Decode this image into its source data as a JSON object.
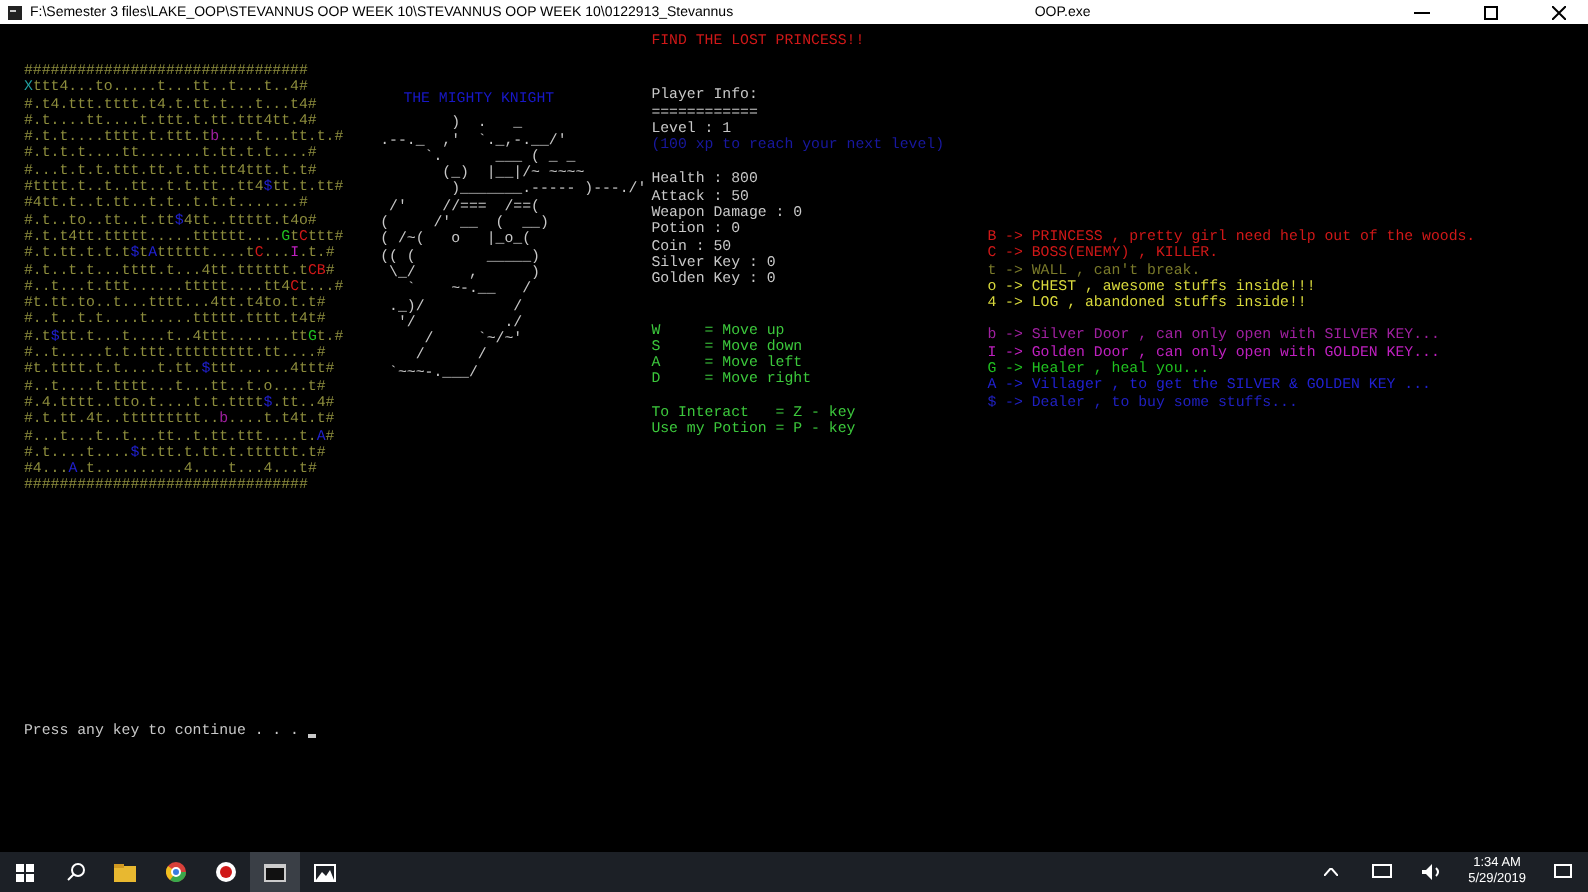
{
  "window": {
    "title": "F:\\Semester 3 files\\LAKE_OOP\\STEVANNUS OOP WEEK 10\\STEVANNUS OOP WEEK 10\\0122913_Stevannus",
    "title_end": "OOP.exe"
  },
  "map": {
    "rows": [
      {
        "segments": [
          {
            "text": "################################"
          }
        ]
      },
      {
        "segments": [
          {
            "text": "X",
            "color": "#20a0a0"
          },
          {
            "text": "ttt4...to.....t...tt..t...t..4#"
          }
        ]
      },
      {
        "segments": [
          {
            "text": "#.t4.ttt.tttt.t4.t.tt.t...t...t4#"
          }
        ]
      },
      {
        "segments": [
          {
            "text": "#.t....tt....t.ttt.t.tt.ttt4tt.4#"
          }
        ]
      },
      {
        "segments": [
          {
            "text": "#.t.t....tttt.t.ttt.t"
          },
          {
            "text": "b",
            "color": "#a020a0"
          },
          {
            "text": "....t...tt.t.#"
          }
        ]
      },
      {
        "segments": [
          {
            "text": "#.t.t.t....tt.......t.tt.t.t....#"
          }
        ]
      },
      {
        "segments": [
          {
            "text": "#...t.t.t.ttt.tt.t.tt.tt4ttt.t.t#"
          }
        ]
      },
      {
        "segments": [
          {
            "text": "#tttt.t..t..tt..t.t.tt..tt4"
          },
          {
            "text": "$",
            "color": "#2020d0"
          },
          {
            "text": "tt.t.tt#"
          }
        ]
      },
      {
        "segments": [
          {
            "text": "#4tt.t..t.tt..t.t..t.t.t.......#"
          }
        ]
      },
      {
        "segments": [
          {
            "text": "#.t..to..tt..t.tt"
          },
          {
            "text": "$",
            "color": "#2020d0"
          },
          {
            "text": "4tt..ttttt.t4o#"
          }
        ]
      },
      {
        "segments": [
          {
            "text": "#.t.t4tt.ttttt.....tttttt...."
          },
          {
            "text": "G",
            "color": "#20c020"
          },
          {
            "text": "t"
          },
          {
            "text": "C",
            "color": "#d01818"
          },
          {
            "text": "ttt#"
          }
        ]
      },
      {
        "segments": [
          {
            "text": "#.t.tt.t.t.t"
          },
          {
            "text": "$",
            "color": "#2020d0"
          },
          {
            "text": "t"
          },
          {
            "text": "A",
            "color": "#2020d0"
          },
          {
            "text": "tttttt....t"
          },
          {
            "text": "C",
            "color": "#d01818"
          },
          {
            "text": "..."
          },
          {
            "text": "I",
            "color": "#c020c0"
          },
          {
            "text": ".t.#"
          }
        ]
      },
      {
        "segments": [
          {
            "text": "#.t..t.t...tttt.t...4tt.tttttt.t"
          },
          {
            "text": "C",
            "color": "#d01818"
          },
          {
            "text": "B",
            "color": "#d01818"
          },
          {
            "text": "#"
          }
        ]
      },
      {
        "segments": [
          {
            "text": "#..t...t.ttt......ttttt....tt4"
          },
          {
            "text": "C",
            "color": "#d01818"
          },
          {
            "text": "t...#"
          }
        ]
      },
      {
        "segments": [
          {
            "text": "#t.tt.to..t...tttt...4tt.t4to.t.t#"
          }
        ]
      },
      {
        "segments": [
          {
            "text": "#..t..t.t....t.....ttttt.tttt.t4t#"
          }
        ]
      },
      {
        "segments": [
          {
            "text": "#.t"
          },
          {
            "text": "$",
            "color": "#2020d0"
          },
          {
            "text": "tt.t...t....t..4ttt.......tt"
          },
          {
            "text": "G",
            "color": "#20c020"
          },
          {
            "text": "t.#"
          }
        ]
      },
      {
        "segments": [
          {
            "text": "#..t.....t.t.ttt.ttttttttt.tt....#"
          }
        ]
      },
      {
        "segments": [
          {
            "text": "#t.tttt.t.t....t.tt."
          },
          {
            "text": "$",
            "color": "#2020d0"
          },
          {
            "text": "ttt......4ttt#"
          }
        ]
      },
      {
        "segments": [
          {
            "text": "#..t....t.tttt...t...tt..t.o....t#"
          }
        ]
      },
      {
        "segments": [
          {
            "text": "#.4.tttt..tto.t....t.t.tttt"
          },
          {
            "text": "$",
            "color": "#2020d0"
          },
          {
            "text": ".tt..4#"
          }
        ]
      },
      {
        "segments": [
          {
            "text": "#.t.tt.4t..ttttttttt.."
          },
          {
            "text": "b",
            "color": "#a020a0"
          },
          {
            "text": "....t.t4t.t#"
          }
        ]
      },
      {
        "segments": [
          {
            "text": "#...t...t..t...tt..t.tt.ttt....t."
          },
          {
            "text": "A",
            "color": "#2020d0"
          },
          {
            "text": "#"
          }
        ]
      },
      {
        "segments": [
          {
            "text": "#.t....t...."
          },
          {
            "text": "$",
            "color": "#2020d0"
          },
          {
            "text": "t.tt.t.tt.t.tttttt.t#"
          }
        ]
      },
      {
        "segments": [
          {
            "text": "#4..."
          },
          {
            "text": "A",
            "color": "#2020d0"
          },
          {
            "text": ".t..........4....t...4...t#"
          }
        ]
      },
      {
        "segments": [
          {
            "text": "################################"
          }
        ]
      }
    ]
  },
  "knight": {
    "title": "THE MIGHTY KNIGHT",
    "art": "         )  .   _\n .--._  ,'  `._,-.__/'\n      `.      ___ ( _ _\n        (_)  |__|/~ ~~~~\n         )_______.----- )---./'\n  /'    //===  /==(\n (     /' __  (  __)\n ( /~(   o   |_o_(\n (( (        _____)\n  \\_/      ,      )\n    `    ~-.__   /\n  ._)/          /\n   '/          ./\n      /     `~/~'\n     /      /\n  `~~~-.___/"
  },
  "info": {
    "heading": "FIND THE LOST PRINCESS!!",
    "title": "Player Info:",
    "separator": "============",
    "level": "Level : 1",
    "xp_hint": "(100 xp to reach your next level)",
    "stats": [
      "Health : 800",
      "Attack : 50",
      "Weapon Damage : 0",
      "Potion : 0",
      "Coin : 50",
      "Silver Key : 0",
      "Golden Key : 0"
    ],
    "moves": [
      "W     = Move up",
      "S     = Move down",
      "A     = Move left",
      "D     = Move right"
    ],
    "actions": [
      "To Interact   = Z - key",
      "Use my Potion = P - key"
    ]
  },
  "legend": {
    "groups": [
      [
        {
          "text": "B -> PRINCESS , pretty girl need help out of the woods.",
          "color": "#d01818"
        },
        {
          "text": "C -> BOSS(ENEMY) , KILLER.",
          "color": "#d01818"
        },
        {
          "text": "t -> WALL , can't break.",
          "color": "#7a7a2a"
        },
        {
          "text": "o -> CHEST , awesome stuffs inside!!!",
          "color": "#d8d83c"
        },
        {
          "text": "4 -> LOG , abandoned stuffs inside!!",
          "color": "#d8d83c"
        }
      ],
      [
        {
          "text": "b -> Silver Door , can only open with SILVER KEY...",
          "color": "#a020a0"
        },
        {
          "text": "I -> Golden Door , can only open with GOLDEN KEY...",
          "color": "#c020c0"
        },
        {
          "text": "G -> Healer , heal you...",
          "color": "#20c020"
        },
        {
          "text": "A -> Villager , to get the SILVER & GOLDEN KEY ...",
          "color": "#2020d0"
        },
        {
          "text": "$ -> Dealer , to buy some stuffs...",
          "color": "#2020c0"
        }
      ]
    ]
  },
  "prompt": "Press any key to continue . . .",
  "taskbar": {
    "time": "1:34 AM",
    "date": "5/29/2019"
  }
}
